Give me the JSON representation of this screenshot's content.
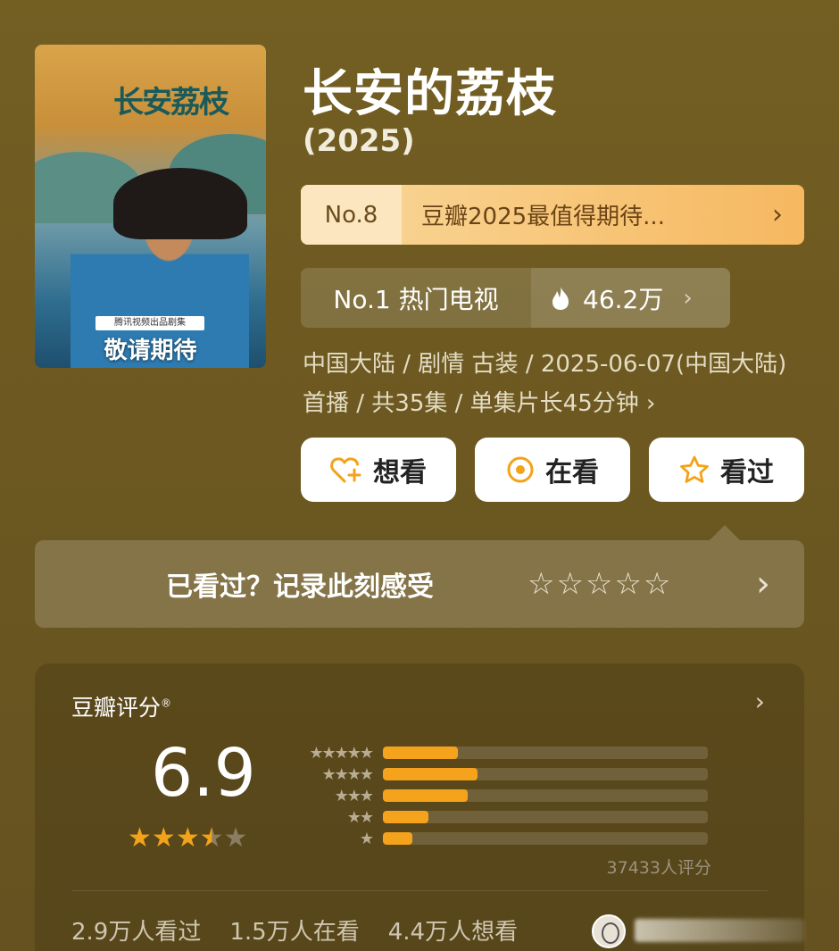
{
  "movie": {
    "title": "长安的荔枝",
    "year": "(2025)",
    "poster": {
      "calligraphy": "长安荔枝",
      "tag": "腾讯视频出品剧集",
      "tagline": "敬请期待"
    },
    "rank": {
      "no": "No.8",
      "text": "豆瓣2025最值得期待...",
      "chevron": "›"
    },
    "hot": {
      "label": "No.1 热门电视",
      "value": "46.2万",
      "icon": "flame-icon",
      "chevron": "›"
    },
    "meta": "中国大陆 / 剧情 古装 / 2025-06-07(中国大陆)首播 / 共35集 / 单集片长45分钟 ›"
  },
  "actions": {
    "want": {
      "icon": "heart-plus-icon",
      "label": "想看"
    },
    "watching": {
      "icon": "target-icon",
      "label": "在看"
    },
    "watched": {
      "icon": "star-icon",
      "label": "看过"
    }
  },
  "record": {
    "text": "已看过？记录此刻感受",
    "stars": "☆☆☆☆☆",
    "chevron": "›"
  },
  "rating": {
    "header": "豆瓣评分",
    "mark": "®",
    "score": "6.9",
    "stars_value": 3.5,
    "distribution": [
      {
        "stars": "★★★★★",
        "fraction": 0.23
      },
      {
        "stars": "★★★★",
        "fraction": 0.29
      },
      {
        "stars": "★★★",
        "fraction": 0.26
      },
      {
        "stars": "★★",
        "fraction": 0.14
      },
      {
        "stars": "★",
        "fraction": 0.09
      }
    ],
    "count": "37433人评分",
    "stats": [
      "2.9万人看过",
      "1.5万人在看",
      "4.4万人想看"
    ],
    "chevron": "›"
  },
  "colors": {
    "background": "#6e5a1f",
    "accent": "#f5a21c",
    "rank_bar": "#f6b860"
  }
}
